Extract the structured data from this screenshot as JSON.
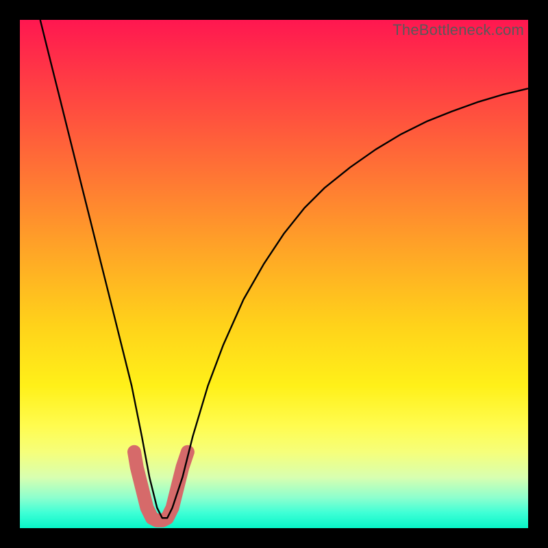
{
  "watermark": "TheBottleneck.com",
  "chart_data": {
    "type": "line",
    "title": "",
    "xlabel": "",
    "ylabel": "",
    "xlim": [
      0,
      100
    ],
    "ylim": [
      0,
      100
    ],
    "grid": false,
    "series": [
      {
        "name": "bottleneck-curve",
        "color": "#000000",
        "x": [
          4,
          6,
          8,
          10,
          12,
          14,
          16,
          18,
          20,
          22,
          24,
          25.5,
          27,
          28,
          29,
          30,
          32,
          34,
          37,
          40,
          44,
          48,
          52,
          56,
          60,
          65,
          70,
          75,
          80,
          85,
          90,
          95,
          100
        ],
        "y": [
          100,
          92,
          84,
          76,
          68,
          60,
          52,
          44,
          36,
          28,
          18,
          10,
          4,
          2,
          2,
          4,
          10,
          18,
          28,
          36,
          45,
          52,
          58,
          63,
          67,
          71,
          74.5,
          77.5,
          80,
          82,
          83.8,
          85.3,
          86.5
        ]
      },
      {
        "name": "tolerance-band",
        "color": "#d66a6a",
        "x": [
          22.5,
          23,
          24,
          25,
          26,
          27,
          28,
          29,
          30,
          31,
          32,
          33
        ],
        "y": [
          15,
          12,
          8,
          4,
          2,
          1.5,
          1.5,
          2,
          4,
          8,
          12,
          15
        ]
      }
    ]
  }
}
